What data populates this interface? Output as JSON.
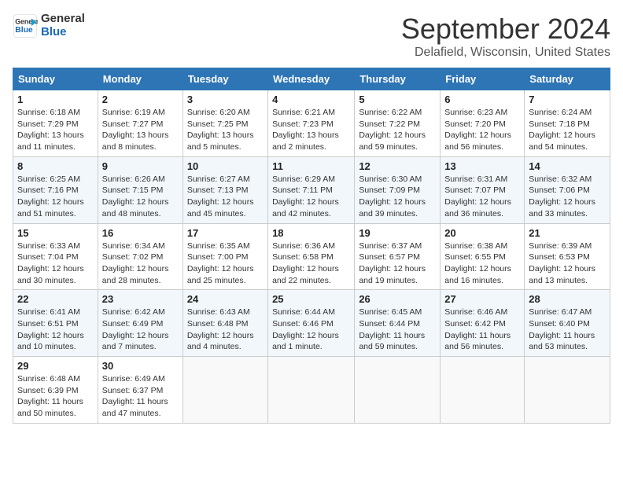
{
  "header": {
    "logo_line1": "General",
    "logo_line2": "Blue",
    "month_title": "September 2024",
    "location": "Delafield, Wisconsin, United States"
  },
  "weekdays": [
    "Sunday",
    "Monday",
    "Tuesday",
    "Wednesday",
    "Thursday",
    "Friday",
    "Saturday"
  ],
  "weeks": [
    [
      {
        "day": "1",
        "info": "Sunrise: 6:18 AM\nSunset: 7:29 PM\nDaylight: 13 hours\nand 11 minutes."
      },
      {
        "day": "2",
        "info": "Sunrise: 6:19 AM\nSunset: 7:27 PM\nDaylight: 13 hours\nand 8 minutes."
      },
      {
        "day": "3",
        "info": "Sunrise: 6:20 AM\nSunset: 7:25 PM\nDaylight: 13 hours\nand 5 minutes."
      },
      {
        "day": "4",
        "info": "Sunrise: 6:21 AM\nSunset: 7:23 PM\nDaylight: 13 hours\nand 2 minutes."
      },
      {
        "day": "5",
        "info": "Sunrise: 6:22 AM\nSunset: 7:22 PM\nDaylight: 12 hours\nand 59 minutes."
      },
      {
        "day": "6",
        "info": "Sunrise: 6:23 AM\nSunset: 7:20 PM\nDaylight: 12 hours\nand 56 minutes."
      },
      {
        "day": "7",
        "info": "Sunrise: 6:24 AM\nSunset: 7:18 PM\nDaylight: 12 hours\nand 54 minutes."
      }
    ],
    [
      {
        "day": "8",
        "info": "Sunrise: 6:25 AM\nSunset: 7:16 PM\nDaylight: 12 hours\nand 51 minutes."
      },
      {
        "day": "9",
        "info": "Sunrise: 6:26 AM\nSunset: 7:15 PM\nDaylight: 12 hours\nand 48 minutes."
      },
      {
        "day": "10",
        "info": "Sunrise: 6:27 AM\nSunset: 7:13 PM\nDaylight: 12 hours\nand 45 minutes."
      },
      {
        "day": "11",
        "info": "Sunrise: 6:29 AM\nSunset: 7:11 PM\nDaylight: 12 hours\nand 42 minutes."
      },
      {
        "day": "12",
        "info": "Sunrise: 6:30 AM\nSunset: 7:09 PM\nDaylight: 12 hours\nand 39 minutes."
      },
      {
        "day": "13",
        "info": "Sunrise: 6:31 AM\nSunset: 7:07 PM\nDaylight: 12 hours\nand 36 minutes."
      },
      {
        "day": "14",
        "info": "Sunrise: 6:32 AM\nSunset: 7:06 PM\nDaylight: 12 hours\nand 33 minutes."
      }
    ],
    [
      {
        "day": "15",
        "info": "Sunrise: 6:33 AM\nSunset: 7:04 PM\nDaylight: 12 hours\nand 30 minutes."
      },
      {
        "day": "16",
        "info": "Sunrise: 6:34 AM\nSunset: 7:02 PM\nDaylight: 12 hours\nand 28 minutes."
      },
      {
        "day": "17",
        "info": "Sunrise: 6:35 AM\nSunset: 7:00 PM\nDaylight: 12 hours\nand 25 minutes."
      },
      {
        "day": "18",
        "info": "Sunrise: 6:36 AM\nSunset: 6:58 PM\nDaylight: 12 hours\nand 22 minutes."
      },
      {
        "day": "19",
        "info": "Sunrise: 6:37 AM\nSunset: 6:57 PM\nDaylight: 12 hours\nand 19 minutes."
      },
      {
        "day": "20",
        "info": "Sunrise: 6:38 AM\nSunset: 6:55 PM\nDaylight: 12 hours\nand 16 minutes."
      },
      {
        "day": "21",
        "info": "Sunrise: 6:39 AM\nSunset: 6:53 PM\nDaylight: 12 hours\nand 13 minutes."
      }
    ],
    [
      {
        "day": "22",
        "info": "Sunrise: 6:41 AM\nSunset: 6:51 PM\nDaylight: 12 hours\nand 10 minutes."
      },
      {
        "day": "23",
        "info": "Sunrise: 6:42 AM\nSunset: 6:49 PM\nDaylight: 12 hours\nand 7 minutes."
      },
      {
        "day": "24",
        "info": "Sunrise: 6:43 AM\nSunset: 6:48 PM\nDaylight: 12 hours\nand 4 minutes."
      },
      {
        "day": "25",
        "info": "Sunrise: 6:44 AM\nSunset: 6:46 PM\nDaylight: 12 hours\nand 1 minute."
      },
      {
        "day": "26",
        "info": "Sunrise: 6:45 AM\nSunset: 6:44 PM\nDaylight: 11 hours\nand 59 minutes."
      },
      {
        "day": "27",
        "info": "Sunrise: 6:46 AM\nSunset: 6:42 PM\nDaylight: 11 hours\nand 56 minutes."
      },
      {
        "day": "28",
        "info": "Sunrise: 6:47 AM\nSunset: 6:40 PM\nDaylight: 11 hours\nand 53 minutes."
      }
    ],
    [
      {
        "day": "29",
        "info": "Sunrise: 6:48 AM\nSunset: 6:39 PM\nDaylight: 11 hours\nand 50 minutes."
      },
      {
        "day": "30",
        "info": "Sunrise: 6:49 AM\nSunset: 6:37 PM\nDaylight: 11 hours\nand 47 minutes."
      },
      {
        "day": "",
        "info": ""
      },
      {
        "day": "",
        "info": ""
      },
      {
        "day": "",
        "info": ""
      },
      {
        "day": "",
        "info": ""
      },
      {
        "day": "",
        "info": ""
      }
    ]
  ]
}
